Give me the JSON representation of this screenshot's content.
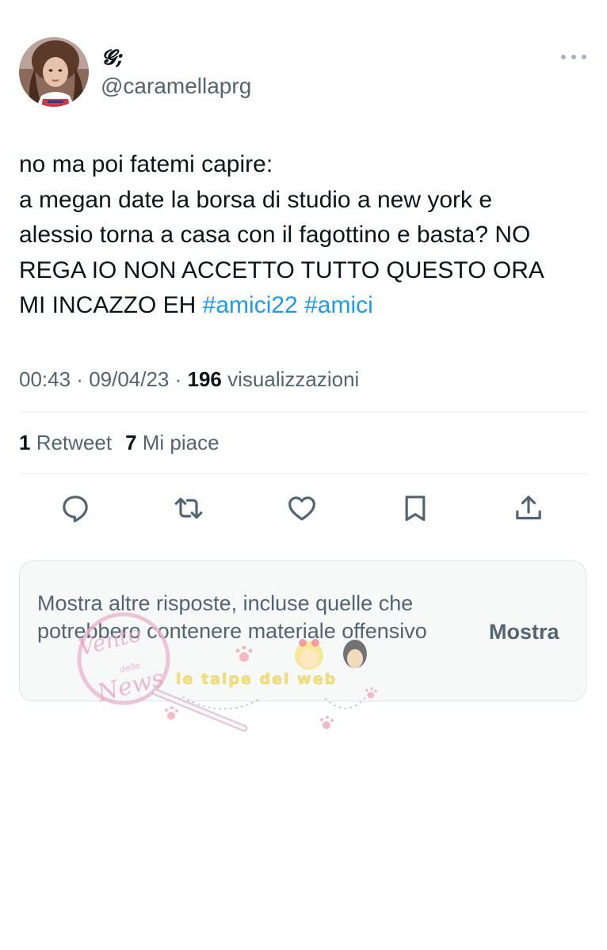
{
  "user": {
    "display_name": "𝓖;",
    "handle": "@caramellaprg"
  },
  "tweet": {
    "lines": [
      "no ma poi fatemi capire:",
      "a megan date la borsa di studio a new york e",
      "alessio torna a casa con il fagottino e basta? NO",
      "REGA IO NON ACCETTO TUTTO QUESTO ORA"
    ],
    "last_line_text": "MI INCAZZO EH ",
    "hashtags": [
      "#amici22",
      "#amici"
    ]
  },
  "meta": {
    "time": "00:43",
    "separator": " · ",
    "date": "09/04/23",
    "views_count": "196",
    "views_label": " visualizzazioni"
  },
  "stats": {
    "retweets_count": "1",
    "retweets_label": " Retweet",
    "likes_count": "7",
    "likes_label": " Mi piace"
  },
  "actions": {
    "icons": [
      "reply-icon",
      "retweet-icon",
      "like-icon",
      "bookmark-icon",
      "share-icon"
    ]
  },
  "notice": {
    "text": "Mostra altre risposte, incluse quelle che potrebbero contenere materiale offensivo",
    "button_label": "Mostra"
  },
  "watermark": {
    "left_logo_lines": [
      "Vento",
      "delle",
      "News"
    ],
    "right_logo_text": "le talpe del web"
  },
  "colors": {
    "text": "#0f1419",
    "secondary": "#536471",
    "hashtag": "#1d9bf0",
    "divider": "#e6ecf0",
    "notice_bg": "#f7f9f9"
  }
}
